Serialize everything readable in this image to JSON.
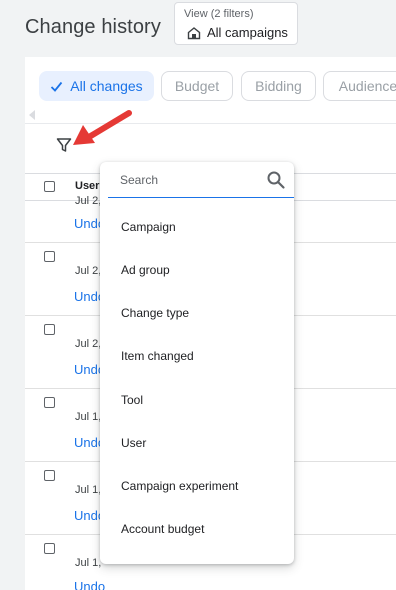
{
  "header": {
    "title": "Change history",
    "view_label": "View (2 filters)",
    "view_value": "All campaigns"
  },
  "chips": [
    {
      "label": "All changes",
      "active": true
    },
    {
      "label": "Budget",
      "active": false
    },
    {
      "label": "Bidding",
      "active": false
    },
    {
      "label": "Audience",
      "active": false
    }
  ],
  "table": {
    "header_user": "User",
    "rows": [
      {
        "user": "",
        "date": "Jul 2,",
        "undo": "Undo"
      },
      {
        "user": "",
        "date": "Jul 2,",
        "undo": "Undo"
      },
      {
        "user": "",
        "date": "Jul 2,",
        "undo": "Undo"
      },
      {
        "user": "",
        "date": "Jul 1,",
        "undo": "Undo"
      },
      {
        "user": "",
        "date": "Jul 1,",
        "undo": "Undo"
      },
      {
        "user": "",
        "date": "Jul 1,",
        "undo": "Undo"
      }
    ]
  },
  "dropdown": {
    "search_placeholder": "Search",
    "items": [
      "Campaign",
      "Ad group",
      "Change type",
      "Item changed",
      "Tool",
      "User",
      "Campaign experiment",
      "Account budget"
    ]
  },
  "colors": {
    "accent": "#1a73e8",
    "annotation": "#e53935",
    "background": "#f1f3f4"
  },
  "icons": {
    "view": "campaigns-icon",
    "filter": "filter-icon",
    "search": "search-icon",
    "check": "check-icon"
  }
}
